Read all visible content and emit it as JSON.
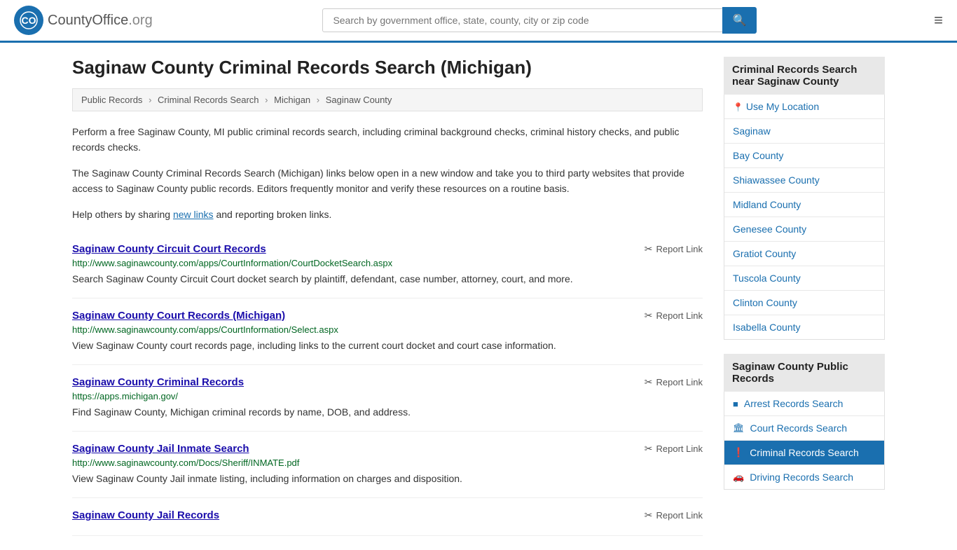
{
  "header": {
    "logo_text": "CountyOffice",
    "logo_suffix": ".org",
    "search_placeholder": "Search by government office, state, county, city or zip code",
    "search_value": ""
  },
  "page": {
    "title": "Saginaw County Criminal Records Search (Michigan)"
  },
  "breadcrumb": {
    "items": [
      "Public Records",
      "Criminal Records Search",
      "Michigan",
      "Saginaw County"
    ]
  },
  "description": {
    "para1": "Perform a free Saginaw County, MI public criminal records search, including criminal background checks, criminal history checks, and public records checks.",
    "para2": "The Saginaw County Criminal Records Search (Michigan) links below open in a new window and take you to third party websites that provide access to Saginaw County public records. Editors frequently monitor and verify these resources on a routine basis.",
    "para3_pre": "Help others by sharing ",
    "para3_link": "new links",
    "para3_post": " and reporting broken links."
  },
  "records": [
    {
      "title": "Saginaw County Circuit Court Records",
      "url": "http://www.saginawcounty.com/apps/CourtInformation/CourtDocketSearch.aspx",
      "description": "Search Saginaw County Circuit Court docket search by plaintiff, defendant, case number, attorney, court, and more.",
      "report_label": "Report Link"
    },
    {
      "title": "Saginaw County Court Records (Michigan)",
      "url": "http://www.saginawcounty.com/apps/CourtInformation/Select.aspx",
      "description": "View Saginaw County court records page, including links to the current court docket and court case information.",
      "report_label": "Report Link"
    },
    {
      "title": "Saginaw County Criminal Records",
      "url": "https://apps.michigan.gov/",
      "description": "Find Saginaw County, Michigan criminal records by name, DOB, and address.",
      "report_label": "Report Link"
    },
    {
      "title": "Saginaw County Jail Inmate Search",
      "url": "http://www.saginawcounty.com/Docs/Sheriff/INMATE.pdf",
      "description": "View Saginaw County Jail inmate listing, including information on charges and disposition.",
      "report_label": "Report Link"
    },
    {
      "title": "Saginaw County Jail Records",
      "url": "",
      "description": "",
      "report_label": "Report Link"
    }
  ],
  "sidebar": {
    "nearby_header": "Criminal Records Search near Saginaw County",
    "nearby_links": [
      {
        "label": "Use My Location",
        "type": "location"
      },
      {
        "label": "Saginaw",
        "type": "link"
      },
      {
        "label": "Bay County",
        "type": "link"
      },
      {
        "label": "Shiawassee County",
        "type": "link"
      },
      {
        "label": "Midland County",
        "type": "link"
      },
      {
        "label": "Genesee County",
        "type": "link"
      },
      {
        "label": "Gratiot County",
        "type": "link"
      },
      {
        "label": "Tuscola County",
        "type": "link"
      },
      {
        "label": "Clinton County",
        "type": "link"
      },
      {
        "label": "Isabella County",
        "type": "link"
      }
    ],
    "public_header": "Saginaw County Public Records",
    "public_links": [
      {
        "label": "Arrest Records Search",
        "icon": "■",
        "active": false
      },
      {
        "label": "Court Records Search",
        "icon": "🏛",
        "active": false
      },
      {
        "label": "Criminal Records Search",
        "icon": "!",
        "active": true
      },
      {
        "label": "Driving Records Search",
        "icon": "🚗",
        "active": false
      }
    ]
  }
}
